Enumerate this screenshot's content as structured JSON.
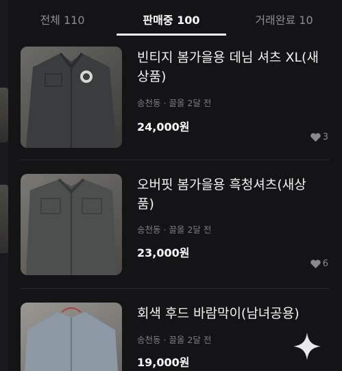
{
  "tabs": [
    {
      "label": "전체 110",
      "active": false
    },
    {
      "label": "판매중 100",
      "active": true
    },
    {
      "label": "거래완료 10",
      "active": false
    }
  ],
  "items": [
    {
      "title": "빈티지 봄가을용 데님 셔츠 XL(새상품)",
      "meta": "송천동 · 끌올 2달 전",
      "price": "24,000원",
      "likes": "3",
      "thumb_icon": "denim-shirt-photo"
    },
    {
      "title": "오버핏 봄가을용 흑청셔츠(새상품)",
      "meta": "송천동 · 끌올 2달 전",
      "price": "23,000원",
      "likes": "6",
      "thumb_icon": "black-denim-shirt-photo"
    },
    {
      "title": "회색 후드 바람막이(남녀공용)",
      "meta": "송천동 · 끌올 2달 전",
      "price": "19,000원",
      "likes": "",
      "thumb_icon": "gray-hood-jacket-photo"
    }
  ],
  "colors": {
    "background": "#141416",
    "active_tab": "#ffffff",
    "inactive_tab": "#8f8f93",
    "meta_text": "#7e7e82"
  },
  "icons": {
    "like": "heart-icon",
    "fab": "sparkle-icon"
  }
}
